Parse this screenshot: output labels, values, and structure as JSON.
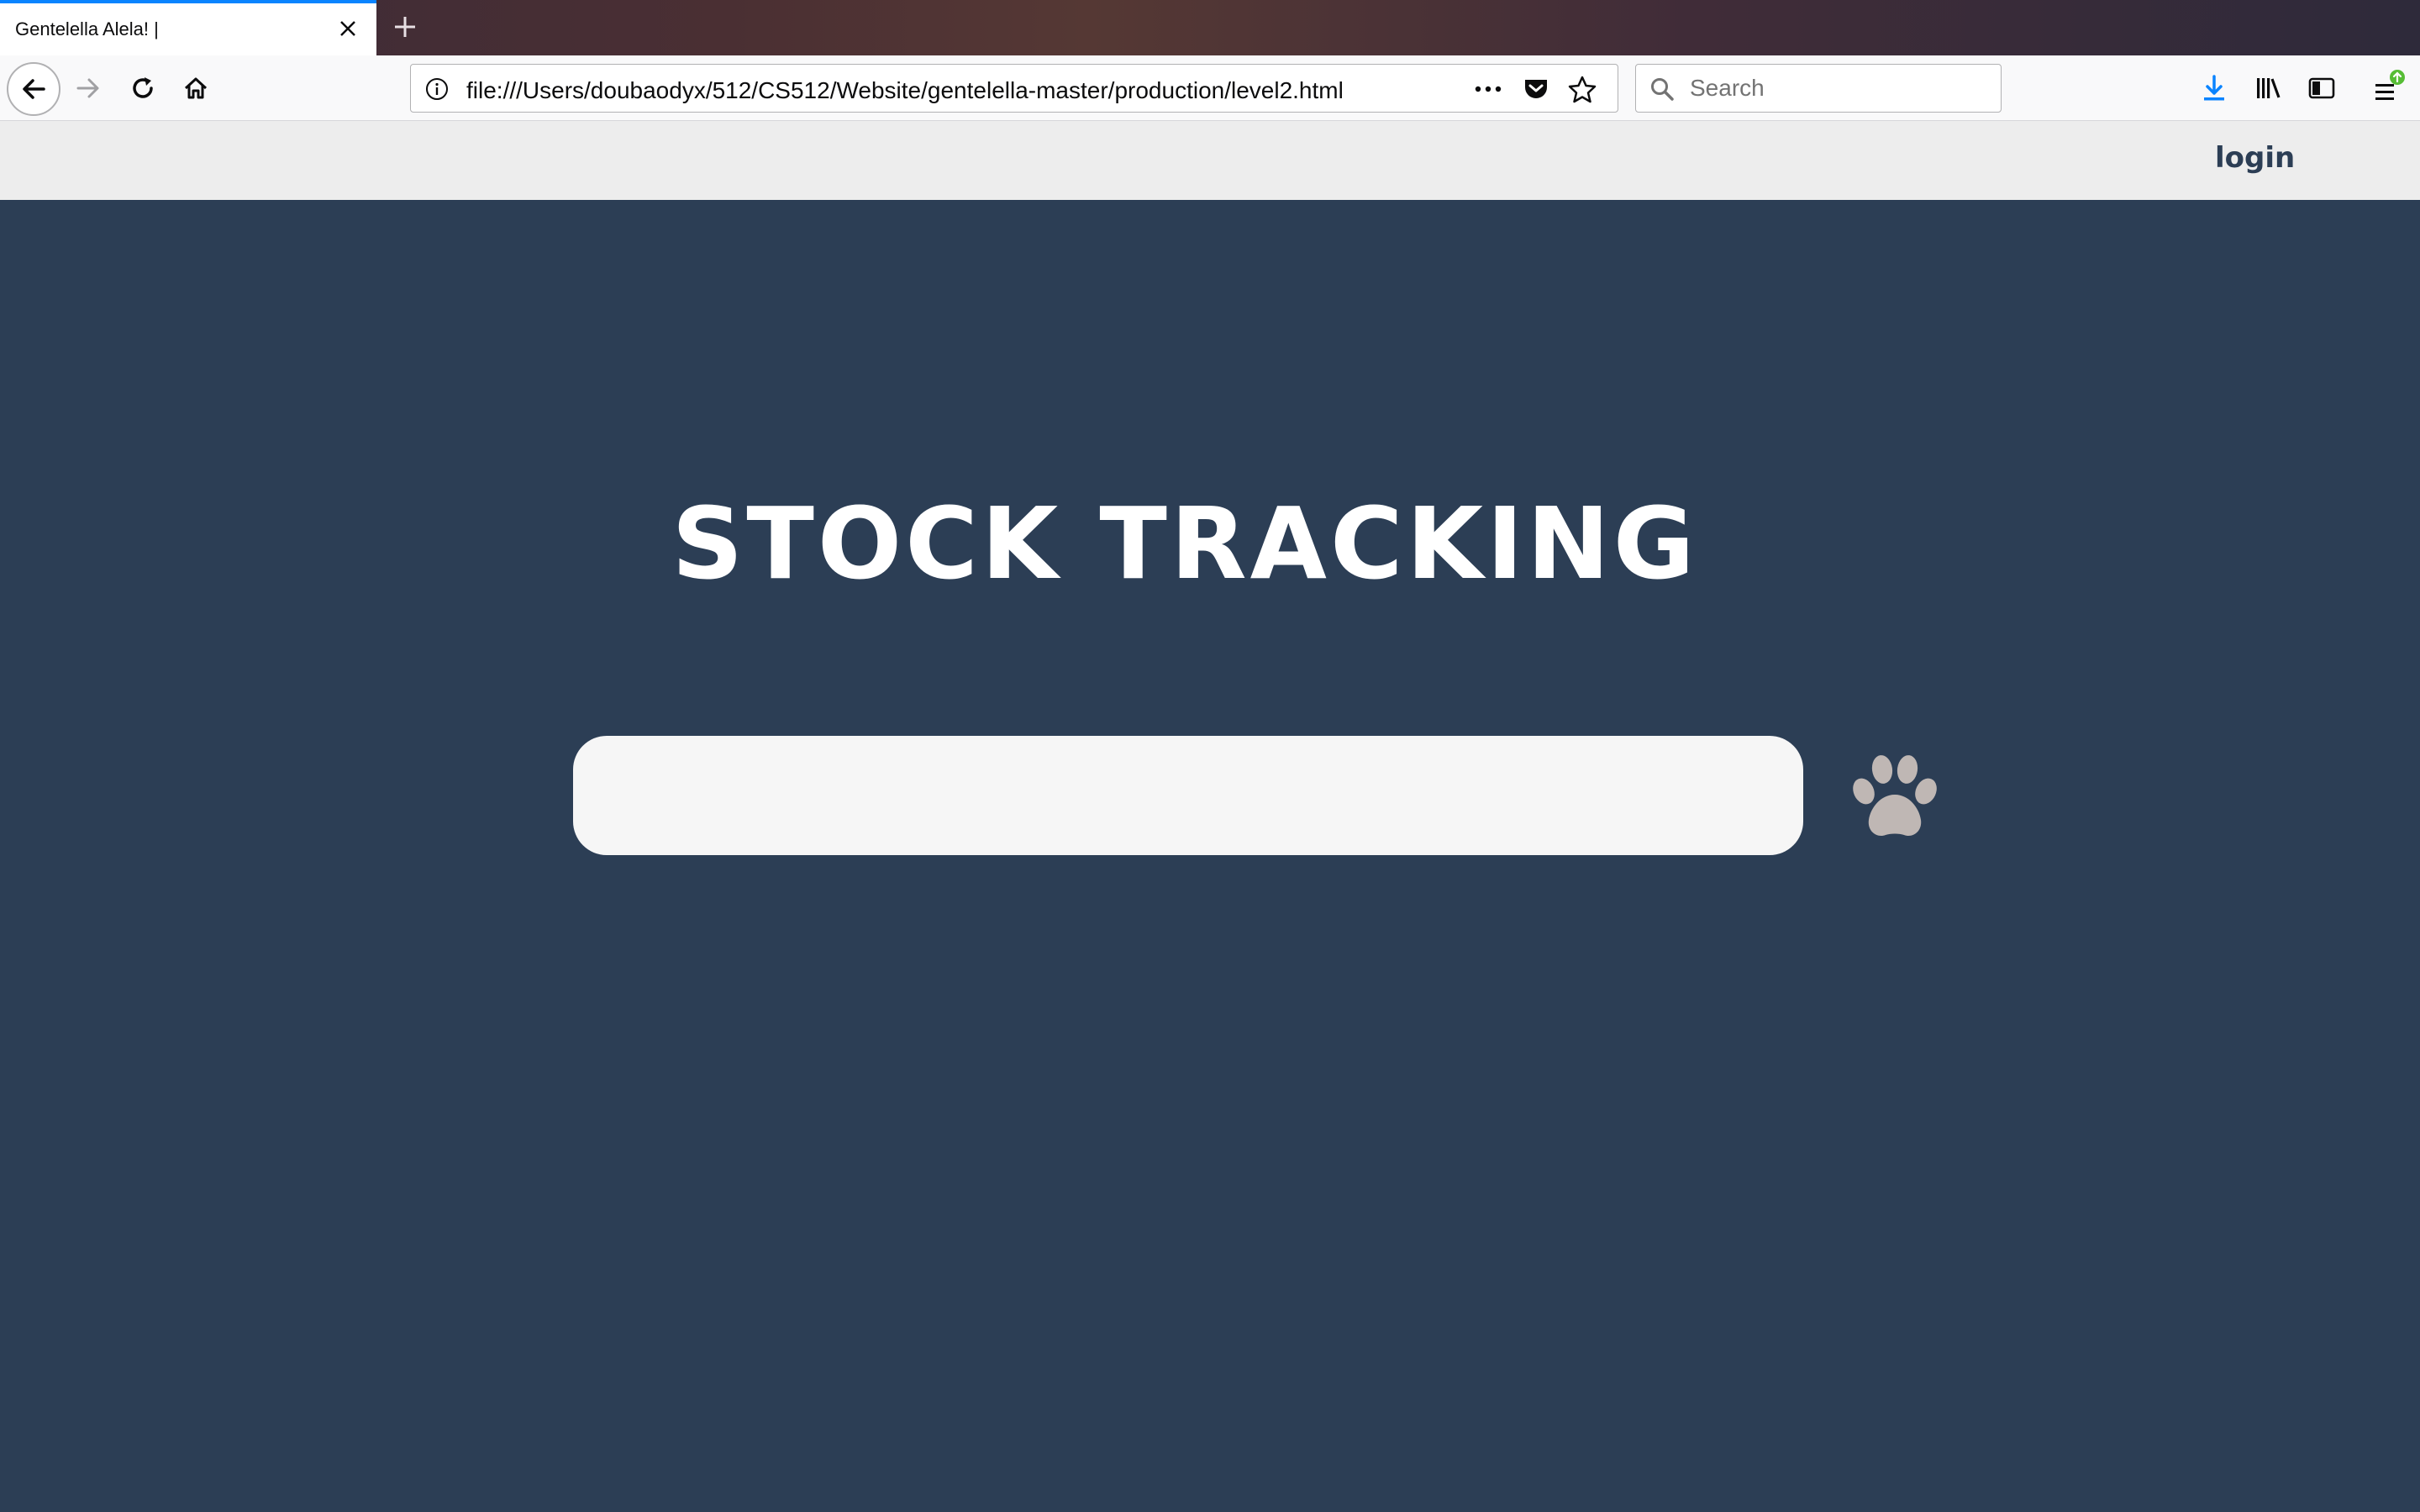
{
  "browser": {
    "tab": {
      "title": "Gentelella Alela! |"
    },
    "url": "file:///Users/doubaodyx/512/CS512/Website/gentelella-master/production/level2.html",
    "search": {
      "placeholder": "Search"
    },
    "icons": {
      "back": "back-arrow-icon",
      "forward": "forward-arrow-icon",
      "reload": "reload-icon",
      "home": "home-icon",
      "info": "info-icon",
      "more": "more-dots-icon",
      "pocket": "pocket-icon",
      "bookmark": "star-icon",
      "downloads": "download-icon",
      "library": "library-icon",
      "sidebar": "sidebar-icon",
      "menu": "hamburger-menu-icon"
    },
    "colors": {
      "accent": "#0a84ff",
      "update_badge": "#57bd35"
    }
  },
  "page": {
    "header": {
      "login_label": "login"
    },
    "title": "STOCK TRACKING",
    "stock_search": {
      "value": "",
      "placeholder": ""
    },
    "search_button_icon": "paw-icon",
    "colors": {
      "background": "#2c3e55",
      "header_background": "#ededed",
      "paw": "#bfb7b4"
    }
  }
}
